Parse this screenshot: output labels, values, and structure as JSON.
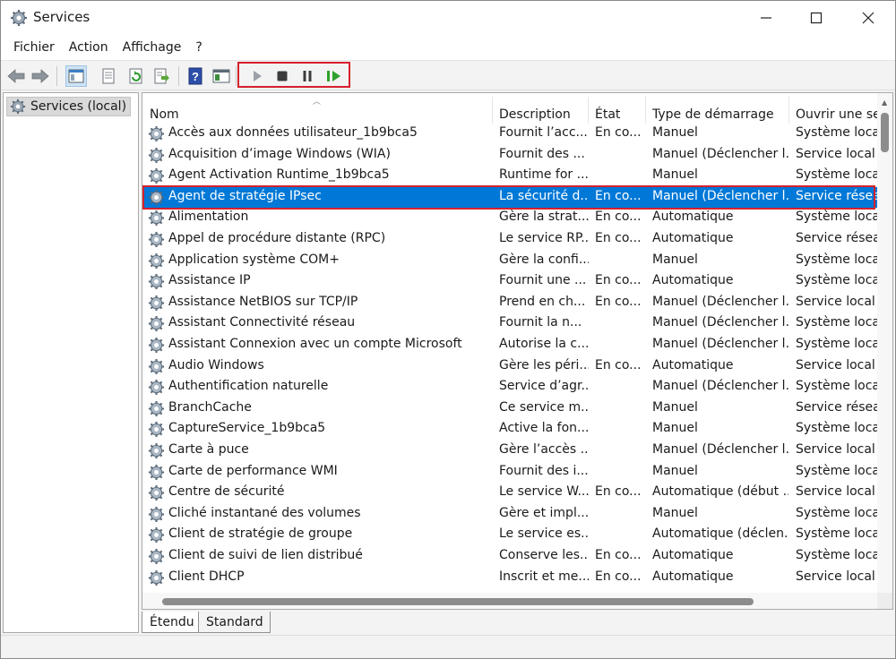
{
  "window": {
    "title": "Services",
    "colors": {
      "selection": "#0078d7",
      "highlight": "#d6202b"
    }
  },
  "menu": [
    "Fichier",
    "Action",
    "Affichage",
    "?"
  ],
  "toolbar": {
    "buttons": [
      "back-arrow-icon",
      "forward-arrow-icon",
      "console-tree-icon",
      "properties-sheet-icon",
      "refresh-icon",
      "export-list-icon",
      "help-icon",
      "mmc-view-icon",
      "start-service-icon",
      "stop-service-icon",
      "pause-service-icon",
      "restart-service-icon"
    ]
  },
  "tree": {
    "root": "Services (local)"
  },
  "table": {
    "columns": [
      "Nom",
      "Description",
      "État",
      "Type de démarrage",
      "Ouvrir une se"
    ],
    "rows": [
      [
        "Accès aux données utilisateur_1b9bca5",
        "Fournit l’acc...",
        "En co...",
        "Manuel",
        "Système local"
      ],
      [
        "Acquisition d’image Windows (WIA)",
        "Fournit des ...",
        "",
        "Manuel (Déclencher l...",
        "Service local"
      ],
      [
        "Agent Activation Runtime_1b9bca5",
        "Runtime for ...",
        "",
        "Manuel",
        "Système local"
      ],
      [
        "Agent de stratégie IPsec",
        "La sécurité d...",
        "En co...",
        "Manuel (Déclencher l...",
        "Service réseau"
      ],
      [
        "Alimentation",
        "Gère la strat...",
        "En co...",
        "Automatique",
        "Système local"
      ],
      [
        "Appel de procédure distante (RPC)",
        "Le service RP...",
        "En co...",
        "Automatique",
        "Service réseau"
      ],
      [
        "Application système COM+",
        "Gère la confi...",
        "",
        "Manuel",
        "Système local"
      ],
      [
        "Assistance IP",
        "Fournit une ...",
        "En co...",
        "Automatique",
        "Système local"
      ],
      [
        "Assistance NetBIOS sur TCP/IP",
        "Prend en ch...",
        "En co...",
        "Manuel (Déclencher l...",
        "Service local"
      ],
      [
        "Assistant Connectivité réseau",
        "Fournit la n...",
        "",
        "Manuel (Déclencher l...",
        "Système local"
      ],
      [
        "Assistant Connexion avec un compte Microsoft",
        "Autorise la c...",
        "",
        "Manuel (Déclencher l...",
        "Système local"
      ],
      [
        "Audio Windows",
        "Gère les péri...",
        "En co...",
        "Automatique",
        "Service local"
      ],
      [
        "Authentification naturelle",
        "Service d’agr...",
        "",
        "Manuel (Déclencher l...",
        "Système local"
      ],
      [
        "BranchCache",
        "Ce service m...",
        "",
        "Manuel",
        "Service réseau"
      ],
      [
        "CaptureService_1b9bca5",
        "Active la fon...",
        "",
        "Manuel",
        "Système local"
      ],
      [
        "Carte à puce",
        "Gère l’accès ...",
        "",
        "Manuel (Déclencher l...",
        "Service local"
      ],
      [
        "Carte de performance WMI",
        "Fournit des i...",
        "",
        "Manuel",
        "Système local"
      ],
      [
        "Centre de sécurité",
        "Le service W...",
        "En co...",
        "Automatique (début ...",
        "Service local"
      ],
      [
        "Cliché instantané des volumes",
        "Gère et impl...",
        "",
        "Manuel",
        "Système local"
      ],
      [
        "Client de stratégie de groupe",
        "Le service es...",
        "",
        "Automatique (déclen...",
        "Système local"
      ],
      [
        "Client de suivi de lien distribué",
        "Conserve les...",
        "En co...",
        "Automatique",
        "Système local"
      ],
      [
        "Client DHCP",
        "Inscrit et me...",
        "En co...",
        "Automatique",
        "Service local"
      ]
    ],
    "selected_row": 3
  },
  "tabs": [
    "Étendu",
    "Standard"
  ]
}
